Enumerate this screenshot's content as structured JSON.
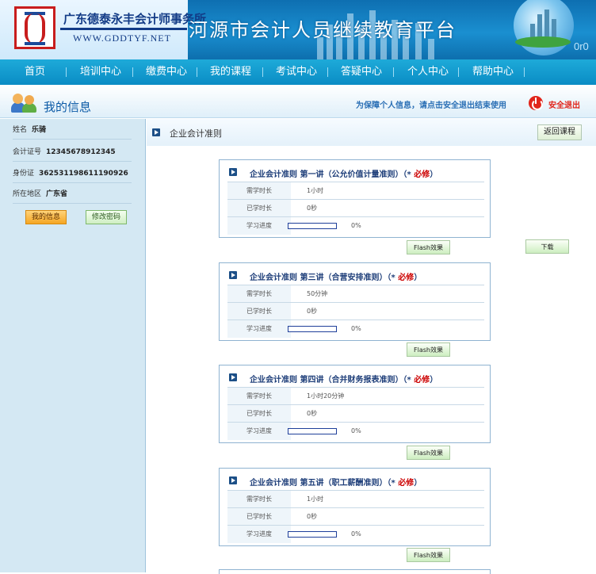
{
  "header": {
    "company_name": "广东德泰永丰会计师事务所",
    "company_url": "WWW.GDDTYF.NET",
    "site_title": "河源市会计人员继续教育平台",
    "corner_text": "0r0"
  },
  "nav": {
    "items": [
      {
        "label": "首页"
      },
      {
        "label": "培训中心"
      },
      {
        "label": "缴费中心"
      },
      {
        "label": "我的课程"
      },
      {
        "label": "考试中心"
      },
      {
        "label": "答疑中心"
      },
      {
        "label": "个人中心"
      },
      {
        "label": "帮助中心"
      }
    ]
  },
  "info_bar": {
    "title": "我的信息",
    "safety_notice": "为保障个人信息，请点击安全退出结束使用",
    "logout_label": "安全退出"
  },
  "sidebar": {
    "fields": [
      {
        "label": "姓名",
        "value": "乐骑"
      },
      {
        "label": "会计证号",
        "value": "12345678912345"
      },
      {
        "label": "身份证",
        "value": "362531198611190926"
      },
      {
        "label": "所在地区",
        "value": "广东省"
      }
    ],
    "my_info_button": "我的信息",
    "change_password_button": "修改密码"
  },
  "main": {
    "title": "企业会计准则",
    "back_button": "返回课程",
    "download_button": "下载",
    "row_labels": {
      "required": "需学时长",
      "learned": "已学时长",
      "progress": "学习进度"
    },
    "flash_label": "Flash效果",
    "courses": [
      {
        "title": "企业会计准则  第一讲（公允价值计量准则）",
        "required_mark": "（* ",
        "required_text": "必修",
        "required_close": "）",
        "required_time": "1小时",
        "learned_time": "0秒",
        "progress_text": "0%",
        "progress": 0
      },
      {
        "title": "企业会计准则  第三讲（合营安排准则）",
        "required_mark": "（* ",
        "required_text": "必修",
        "required_close": "）",
        "required_time": "50分钟",
        "learned_time": "0秒",
        "progress_text": "0%",
        "progress": 0
      },
      {
        "title": "企业会计准则  第四讲（合并财务报表准则）",
        "required_mark": "（* ",
        "required_text": "必修",
        "required_close": "）",
        "required_time": "1小时20分钟",
        "learned_time": "0秒",
        "progress_text": "0%",
        "progress": 0
      },
      {
        "title": "企业会计准则  第五讲（职工薪酬准则）",
        "required_mark": "（* ",
        "required_text": "必修",
        "required_close": "）",
        "required_time": "1小时",
        "learned_time": "0秒",
        "progress_text": "0%",
        "progress": 0
      }
    ]
  },
  "colors": {
    "nav_bg": "#0a8cc4",
    "required_red": "#cc0000",
    "title_blue": "#1f3f7a",
    "sidebar_bg": "#d4e8f3"
  }
}
